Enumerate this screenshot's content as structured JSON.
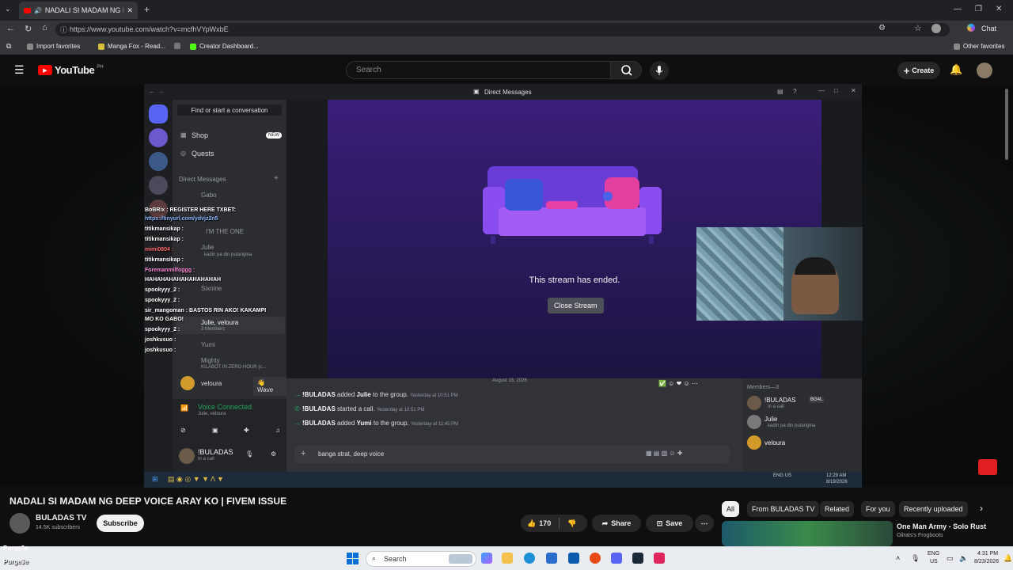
{
  "browser": {
    "tab_title": "NADALI SI MADAM NG DEEP",
    "url": "https://www.youtube.com/watch?v=mcfhVYpWxbE",
    "chat_label": "Chat",
    "bookmarks": [
      "Import favorites",
      "Manga Fox - Read...",
      "Creator Dashboard..."
    ],
    "other_favorites": "Other favorites"
  },
  "youtube": {
    "logo": "YouTube",
    "region": "PH",
    "search_placeholder": "Search",
    "create_label": "Create"
  },
  "discord": {
    "window_title": "Direct Messages",
    "find_conversation": "Find or start a conversation",
    "shop": "Shop",
    "new_badge": "NEW",
    "quests": "Quests",
    "dm_header": "Direct Messages",
    "dm_list": [
      "Gabo",
      "I'M THE ONE",
      "Julie",
      "Sixnine",
      "Julie, veloura",
      "Yumi",
      "Mighty",
      "veloura"
    ],
    "dm_sub": [
      "kadiri pa din putangina",
      "3 Members",
      "KILABOT IN ZERO HOUR (c..."
    ],
    "wave": "Wave",
    "voice_connected": "Voice Connected",
    "voice_sub": "Julie, veloura",
    "user_name": "!BULADAS",
    "user_status": "In a call",
    "stream_ended": "This stream has ended.",
    "close_stream": "Close Stream",
    "date_divider": "August 18, 2026",
    "messages": [
      {
        "user": "!BULADAS",
        "action": "added",
        "target": "Julie",
        "rest": "to the group.",
        "time": "Yesterday at 10:51 PM"
      },
      {
        "user": "!BULADAS",
        "action": "started a call.",
        "target": "",
        "rest": "",
        "time": "Yesterday at 10:51 PM"
      },
      {
        "user": "!BULADAS",
        "action": "added",
        "target": "Yumi",
        "rest": "to the group.",
        "time": "Yesterday at 11:45 PM"
      }
    ],
    "composer_text": "banga strat, deep voice",
    "members_header": "Members—3",
    "members": [
      {
        "name": "!BULADAS",
        "tag": "BG4L",
        "status": "In a call"
      },
      {
        "name": "Julie",
        "tag": "",
        "status": "kadiri pa din putangina"
      },
      {
        "name": "veloura",
        "tag": "",
        "status": ""
      }
    ],
    "inner_clock": "12:29 AM",
    "inner_date": "8/19/2026",
    "inner_lang": "ENG US"
  },
  "overlay_chat": [
    "BoBRix : REGISTER HERE TXBET:",
    "https://tinyurl.com/ydvjz2n5",
    "titikmansikap :",
    "titikmansikap :",
    "mimi0804 :",
    "titikmansikap :",
    "Foremanmilfoggg :",
    "HAHAHAHAHAHAHAHAHAH",
    "spookyyy_2 :",
    "spookyyy_2 :",
    "sir_mangoman : BASTOS RIN AKO! KAKAMPI",
    "MO KO GABO!",
    "spookyyy_2 :",
    "joshkusuo :",
    "joshkusuo :"
  ],
  "video": {
    "title": "NADALI SI MADAM NG DEEP VOICE ARAY KO | FIVEM ISSUE",
    "channel": "BULADAS TV",
    "subscribers": "14.5K subscribers",
    "subscribe": "Subscribe",
    "likes": "170",
    "share": "Share",
    "save": "Save"
  },
  "chips": [
    "All",
    "From BULADAS TV",
    "Related",
    "For you",
    "Recently uploaded"
  ],
  "suggestion": {
    "title": "One Man Army - Solo Rust",
    "channel": "Oilrats's Frogboots"
  },
  "bottom_left": [
    "Purge3e",
    "Purge3e"
  ],
  "windows": {
    "search": "Search",
    "lang": "ENG",
    "region": "US",
    "time": "4:31 PM",
    "date": "8/23/2026"
  }
}
